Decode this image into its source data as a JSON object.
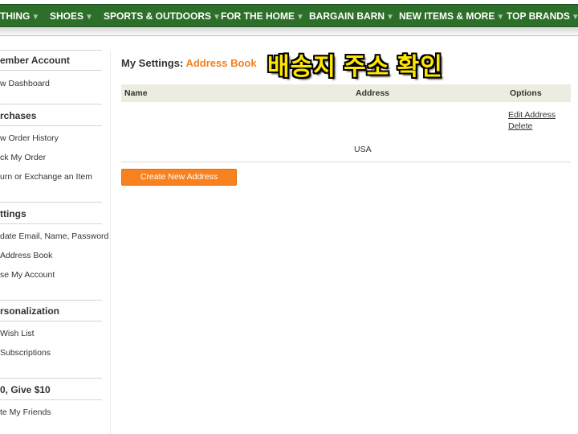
{
  "nav": {
    "items": [
      {
        "label": "THING"
      },
      {
        "label": "SHOES"
      },
      {
        "label": "SPORTS & OUTDOORS"
      },
      {
        "label": "FOR THE HOME"
      },
      {
        "label": "BARGAIN BARN"
      },
      {
        "label": "NEW ITEMS & MORE"
      },
      {
        "label": "TOP BRANDS"
      }
    ],
    "caret": "▼",
    "color": "#2c6e2a"
  },
  "sidebar": {
    "sections": [
      {
        "heading": "ember Account",
        "links": [
          "w Dashboard"
        ]
      },
      {
        "heading": "rchases",
        "links": [
          "w Order History",
          "ck My Order",
          "urn or Exchange an Item"
        ]
      },
      {
        "heading": "ttings",
        "links": [
          "date Email, Name, Password",
          "Address Book",
          "se My Account"
        ]
      },
      {
        "heading": "rsonalization",
        "links": [
          "Wish List",
          "Subscriptions"
        ]
      },
      {
        "heading": "0, Give $10",
        "links": [
          "te My Friends"
        ]
      }
    ]
  },
  "page": {
    "title_prefix": "My Settings:",
    "title_accent": "Address Book",
    "accent_color": "#f0821e",
    "overlay_text": "배송지 주소 확인"
  },
  "table": {
    "headers": {
      "name": "Name",
      "address": "Address",
      "options": "Options"
    },
    "rows": [
      {
        "name": "",
        "address": "USA",
        "options": [
          "Edit Address",
          "Delete"
        ]
      }
    ]
  },
  "buttons": {
    "create": "Create New Address"
  }
}
